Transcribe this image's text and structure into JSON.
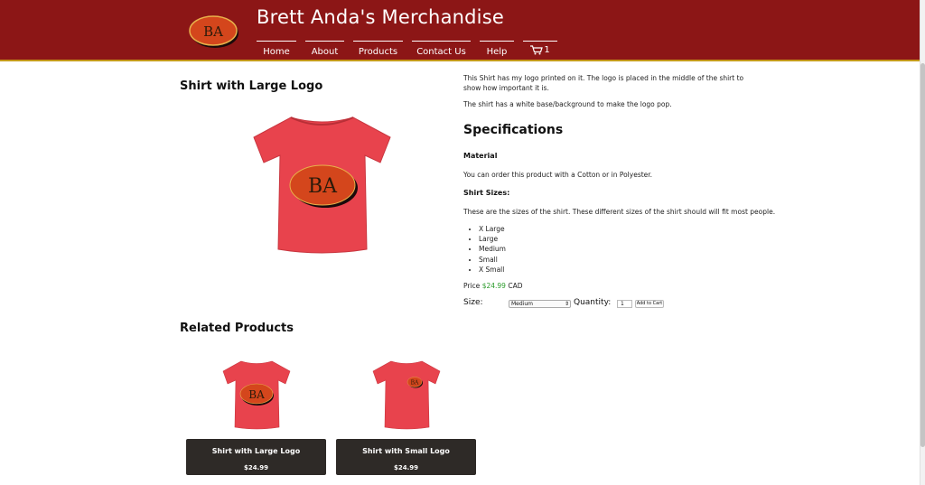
{
  "header": {
    "logo_text": "BA",
    "title": "Brett Anda's Merchandise",
    "nav": [
      "Home",
      "About",
      "Products",
      "Contact Us",
      "Help"
    ],
    "cart_count": "1",
    "colors": {
      "background": "#8c1616",
      "accent": "#c59a1a"
    }
  },
  "product": {
    "title": "Shirt with Large Logo",
    "shirt_logo": "BA",
    "description": [
      "This Shirt has my logo printed on it. The logo is placed in the middle of the shirt to show how important it is.",
      "The shirt has a white base/background to make the logo pop."
    ],
    "specifications_title": "Specifications",
    "material_title": "Material",
    "material_text": "You can order this product with a Cotton or in Polyester.",
    "sizes_title": "Shirt Sizes:",
    "sizes_text": "These are the sizes of the shirt. These different sizes of the shirt should will fit most people.",
    "sizes": [
      "X Large",
      "Large",
      "Medium",
      "Small",
      "X Small"
    ],
    "price_prefix": "Price",
    "price": "$24.99",
    "currency": "CAD",
    "size_label": "Size:",
    "size_selected": "Medium",
    "quantity_label": "Quantity:",
    "quantity_value": "1",
    "add_to_cart": "Add to Cart"
  },
  "related": {
    "title": "Related Products",
    "items": [
      {
        "name": "Shirt with Large Logo",
        "price": "$24.99",
        "logo": "BA"
      },
      {
        "name": "Shirt with Small Logo",
        "price": "$24.99",
        "logo": "BA"
      }
    ]
  }
}
